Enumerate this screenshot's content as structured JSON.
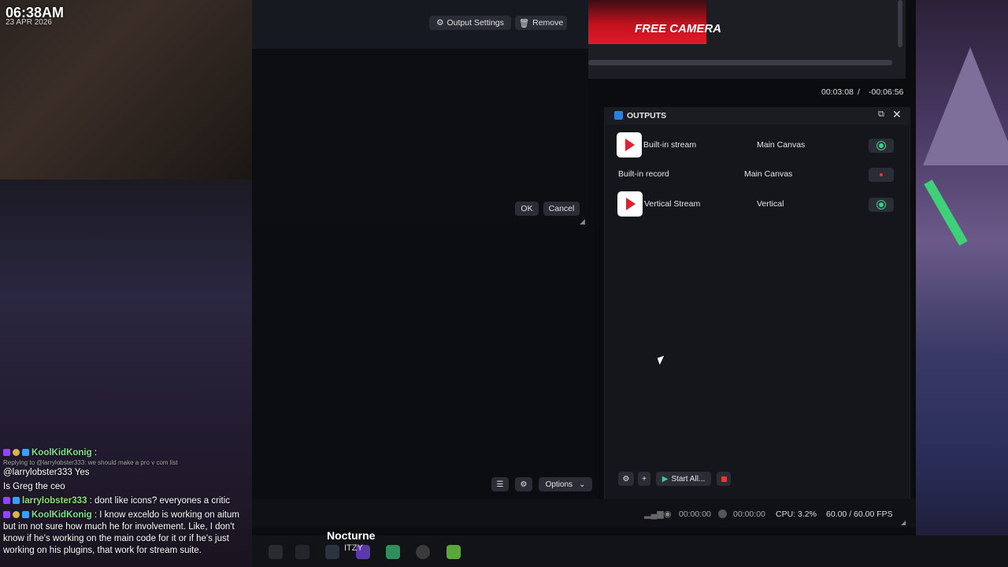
{
  "overlay": {
    "clock": "06:38AM",
    "date": "23 APR 2026"
  },
  "chat": {
    "messages": [
      {
        "user": "KoolKidKonig",
        "sep": " :",
        "reply_note": "Replying to @larrylobster333: we should make a pro v com list",
        "text": "@larrylobster333 Yes"
      },
      {
        "user": "",
        "sep": "",
        "reply_note": "",
        "text": "Is Greg the ceo"
      },
      {
        "user": "larrylobster333",
        "sep": " :",
        "reply_note": "",
        "text": " dont like icons? everyones a critic"
      },
      {
        "user": "KoolKidKonig",
        "sep": " :",
        "reply_note": "",
        "text": " I know exceldo is working on aitum but im not sure how much he for involvement. Like, I don't know if he's working on the main code for it or if he's just working on his plugins, that work for stream suite."
      }
    ]
  },
  "dialog": {
    "output_settings_label": "Output Settings",
    "remove_label": "Remove",
    "ok_label": "OK",
    "cancel_label": "Cancel"
  },
  "preview": {
    "banner_text": "FREE CAMERA",
    "time_elapsed": "00:03:08",
    "time_sep": "/",
    "time_remaining": "-00:06:56"
  },
  "outputs": {
    "title": "OUTPUTS",
    "rows": [
      {
        "name": "Built-in stream",
        "canvas": "Main Canvas",
        "icon": "youtube-icon",
        "action": "live"
      },
      {
        "name": "Built-in record",
        "canvas": "Main Canvas",
        "icon": "",
        "action": "record"
      },
      {
        "name": "Vertical Stream",
        "canvas": "Vertical",
        "icon": "youtube-icon",
        "action": "live"
      }
    ],
    "start_all_label": "Start All..."
  },
  "toolbar": {
    "options_label": "Options"
  },
  "statusbar": {
    "stream_time": "00:00:00",
    "rec_time": "00:00:00",
    "cpu": "CPU: 3.2%",
    "fps": "60.00 / 60.00 FPS"
  },
  "now_playing": {
    "title": "Nocturne",
    "artist": "ITZY"
  },
  "colors": {
    "accent_green": "#3ad08b",
    "record_red": "#e23a3a",
    "panel_bg": "#14161b"
  }
}
